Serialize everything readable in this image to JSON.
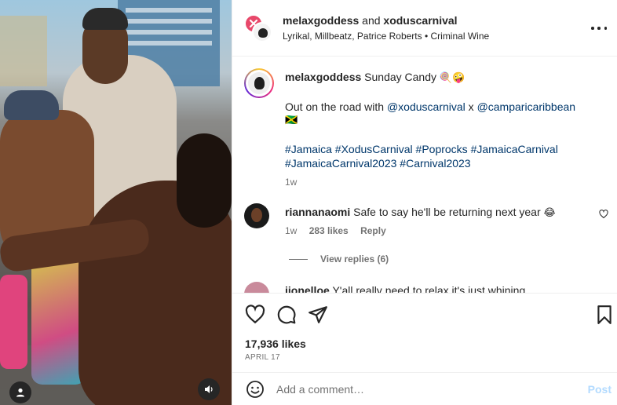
{
  "post": {
    "header": {
      "user1": "melaxgoddess",
      "and": "and",
      "user2": "xoduscarnival",
      "music": "Lyrikal, Millbeatz, Patrice Roberts • Criminal Wine"
    },
    "caption": {
      "username": "melaxgoddess",
      "line1_text": "Sunday Candy",
      "line1_emoji": "🍭🤪",
      "line2_prefix": "Out on the road with",
      "mention1": "@xoduscarnival",
      "x": "x",
      "mention2": "@camparicaribbean",
      "flag": "🇯🇲",
      "hashtags1": "#Jamaica #XodusCarnival #Poprocks #JamaicaCarnival",
      "hashtags2": "#JamaicaCarnival2023 #Carnival2023",
      "time": "1w"
    },
    "comments": [
      {
        "username": "riannanaomi",
        "text": "Safe to say he'll be returning next year",
        "emoji": "😂",
        "time": "1w",
        "likes": "283 likes",
        "reply": "Reply"
      },
      {
        "username": "jionelloe",
        "text": "Y'all really need to relax it's just whining"
      }
    ],
    "view_replies": "View replies (6)",
    "likes": "17,936 likes",
    "date": "APRIL 17",
    "add_comment_placeholder": "Add a comment…",
    "post_button": "Post"
  },
  "icons": {
    "media_user": "user-tag-icon",
    "media_sound": "speaker-icon",
    "more": "more-options-icon",
    "like": "heart-icon",
    "comment": "comment-icon",
    "share": "share-icon",
    "save": "bookmark-icon",
    "emoji": "emoji-icon"
  },
  "colors": {
    "link": "#00376b",
    "muted": "#737373",
    "post_disabled": "#b3dbff"
  }
}
